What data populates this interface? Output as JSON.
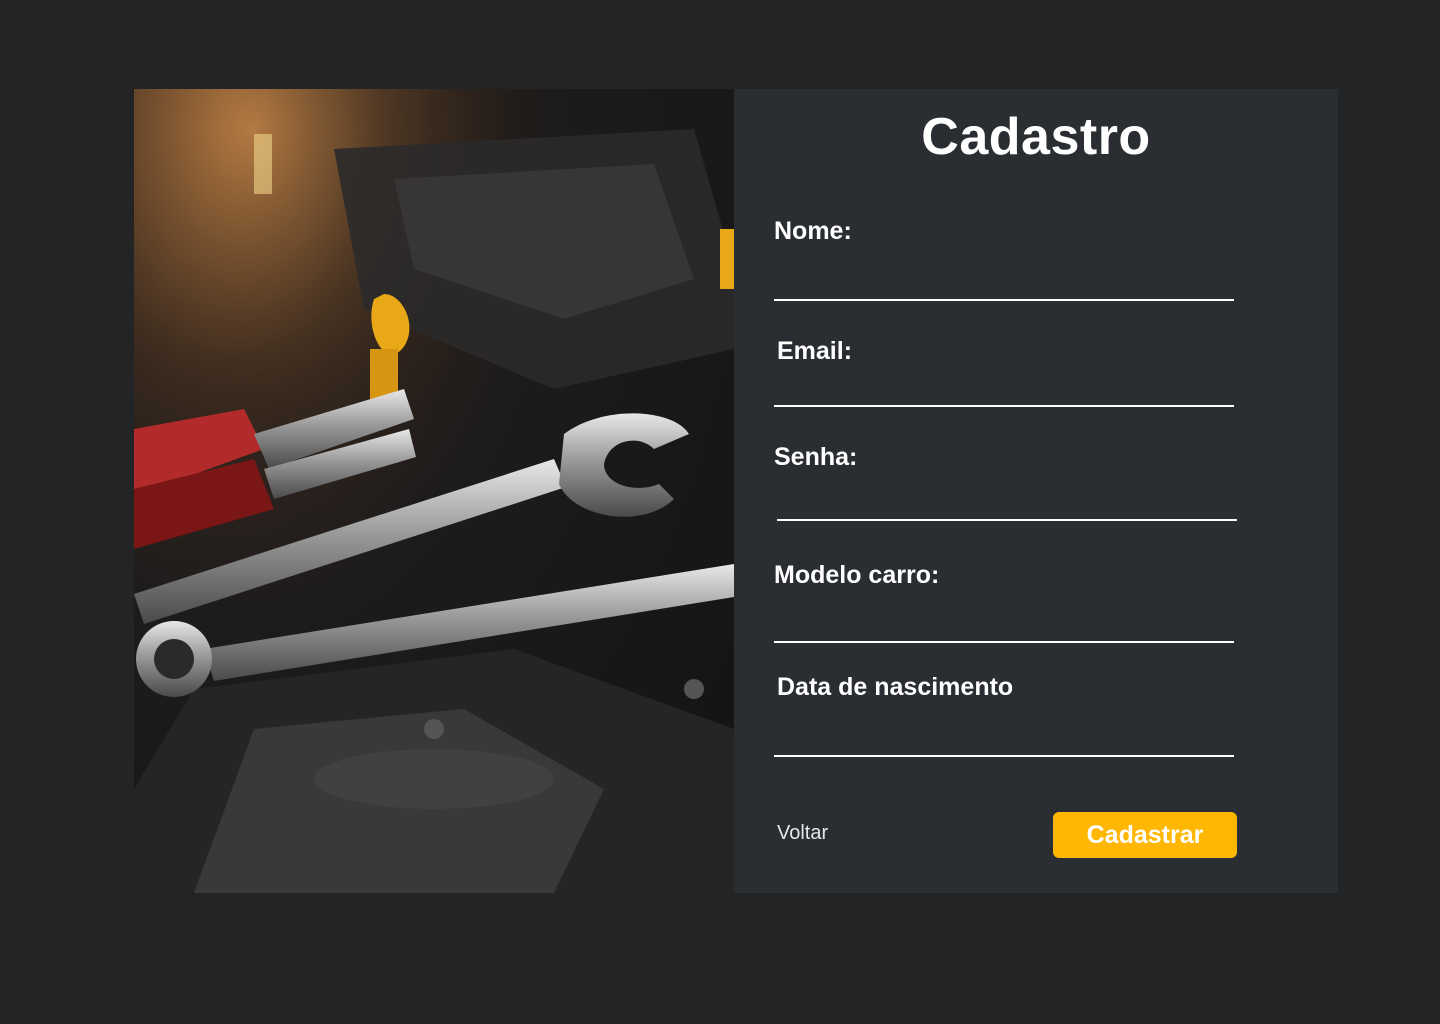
{
  "title": "Cadastro",
  "photo": {
    "icon": "wrench-tools-engine-photo"
  },
  "fields": [
    {
      "label": "Nome:",
      "value": ""
    },
    {
      "label": "Email:",
      "value": ""
    },
    {
      "label": "Senha:",
      "value": ""
    },
    {
      "label": "Modelo carro:",
      "value": ""
    },
    {
      "label": "Data de nascimento",
      "value": ""
    }
  ],
  "actions": {
    "back_label": "Voltar",
    "submit_label": "Cadastrar"
  },
  "colors": {
    "background": "#232426",
    "panel": "#2a2e32",
    "accent": "#ffb703",
    "text": "#ffffff"
  }
}
